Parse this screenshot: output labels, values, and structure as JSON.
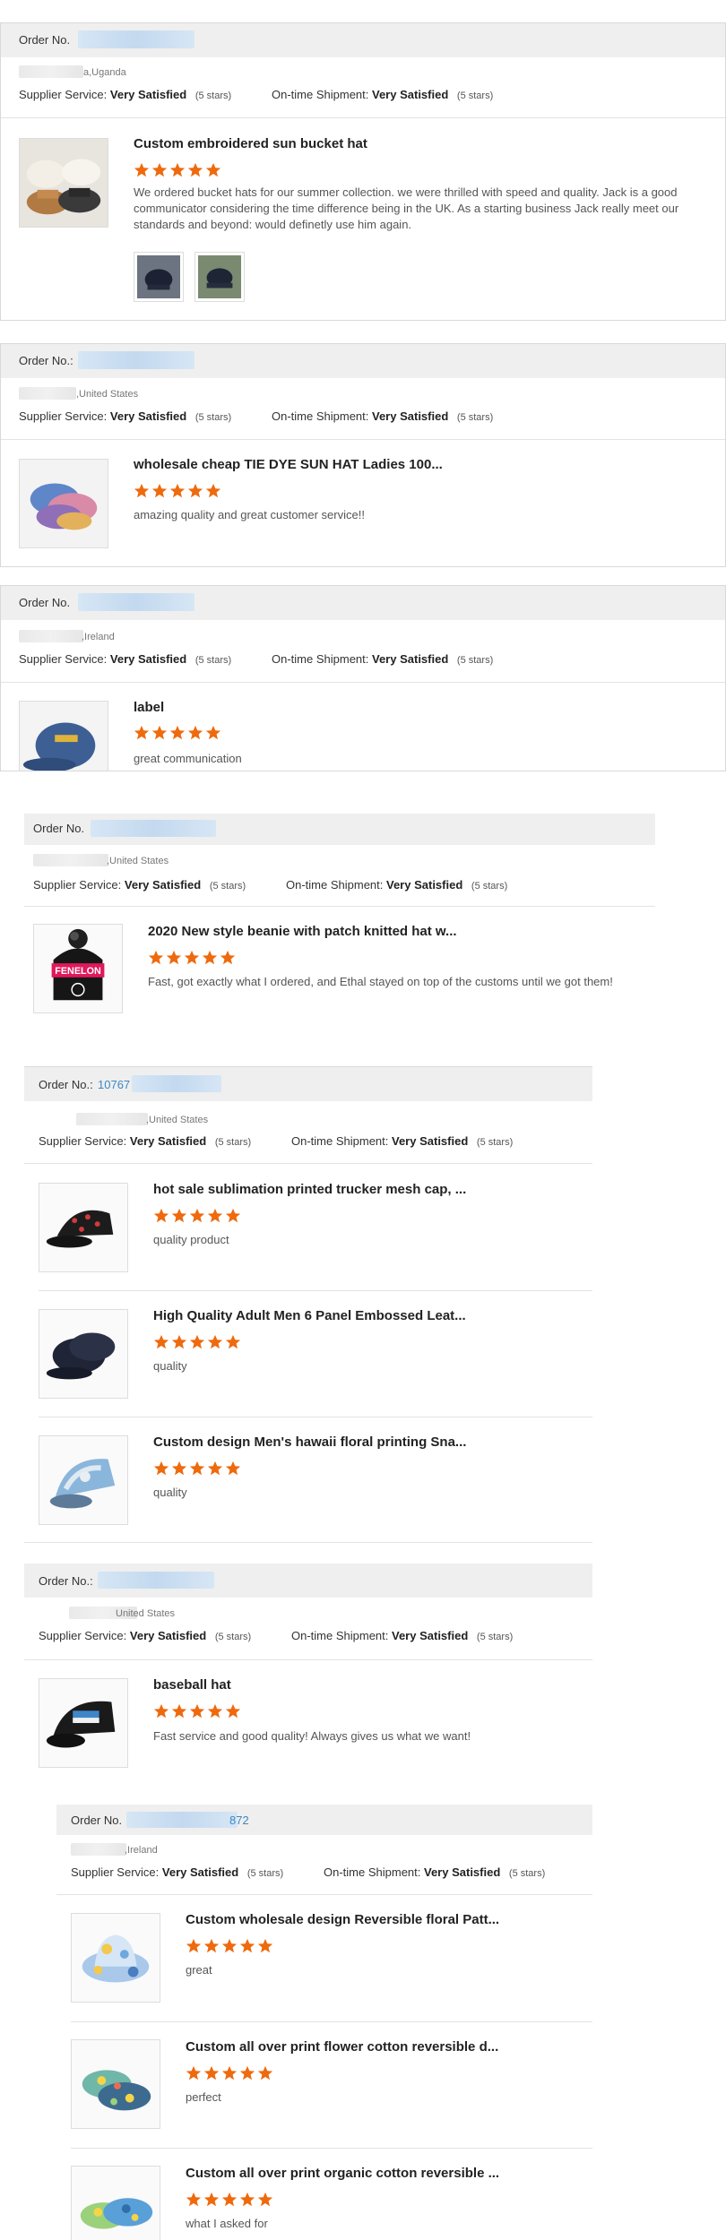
{
  "labels": {
    "order_no": "Order No.",
    "order_no_colon": "Order No.:",
    "supplier_service": "Supplier Service:",
    "ontime_shipment": "On-time Shipment:",
    "rating_text": "Very Satisfied",
    "rating_stars": "(5 stars)"
  },
  "colors": {
    "star": "#ee6a0d",
    "header_bg": "#efefef",
    "order_link": "#3b88c3"
  },
  "reviews": [
    {
      "order_number": "",
      "location": "a,Uganda",
      "items": [
        {
          "title": "Custom embroidered sun bucket hat",
          "rating": 5,
          "comment": "We ordered bucket hats for our summer collection. we were thrilled with speed and quality. Jack is a good communicator considering the time difference being in the UK. As a starting business Jack really meet our standards and beyond: would definetly use him again.",
          "image_icon": "bucket-hats-image",
          "photo_icons": [
            "cap-photo-1",
            "cap-photo-2"
          ]
        }
      ]
    },
    {
      "order_number": "",
      "location": ",United States",
      "items": [
        {
          "title": "wholesale cheap TIE DYE SUN HAT Ladies 100...",
          "rating": 5,
          "comment": "amazing quality and great customer service!!",
          "image_icon": "tie-dye-hats-image"
        }
      ]
    },
    {
      "order_number": "",
      "location": ",Ireland",
      "items": [
        {
          "title": "label",
          "rating": 5,
          "comment": "great communication",
          "image_icon": "blue-cap-image"
        }
      ]
    },
    {
      "order_number": "",
      "location": ",United States",
      "items": [
        {
          "title": "2020 New style beanie with patch knitted hat w...",
          "rating": 5,
          "comment": "Fast, got exactly what I ordered, and Ethal stayed on top of the customs until we got them!",
          "image_icon": "fenelon-beanie-image",
          "image_text": "FENELON"
        }
      ]
    },
    {
      "order_number": "10767",
      "location": ",United States",
      "items": [
        {
          "title": "hot sale sublimation printed trucker mesh cap, ...",
          "rating": 5,
          "comment": "quality product",
          "image_icon": "trucker-cap-image"
        },
        {
          "title": "High Quality Adult Men 6 Panel Embossed Leat...",
          "rating": 5,
          "comment": "quality",
          "image_icon": "embossed-caps-image"
        },
        {
          "title": "Custom design Men's hawaii floral printing Sna...",
          "rating": 5,
          "comment": "quality",
          "image_icon": "hawaii-cap-image"
        }
      ]
    },
    {
      "order_number": "",
      "location": "United States",
      "items": [
        {
          "title": "baseball hat",
          "rating": 5,
          "comment": "Fast service and good quality! Always gives us what we want!",
          "image_icon": "patch-cap-image"
        }
      ]
    },
    {
      "order_number": "872",
      "location": ",Ireland",
      "items": [
        {
          "title": "Custom wholesale design Reversible floral Patt...",
          "rating": 5,
          "comment": "great",
          "image_icon": "floral-bucket-image"
        },
        {
          "title": "Custom all over print flower cotton reversible d...",
          "rating": 5,
          "comment": "perfect",
          "image_icon": "flower-bucket-image"
        },
        {
          "title": "Custom all over print organic cotton reversible ...",
          "rating": 5,
          "comment": "what I asked for",
          "image_icon": "organic-bucket-image"
        }
      ]
    }
  ]
}
